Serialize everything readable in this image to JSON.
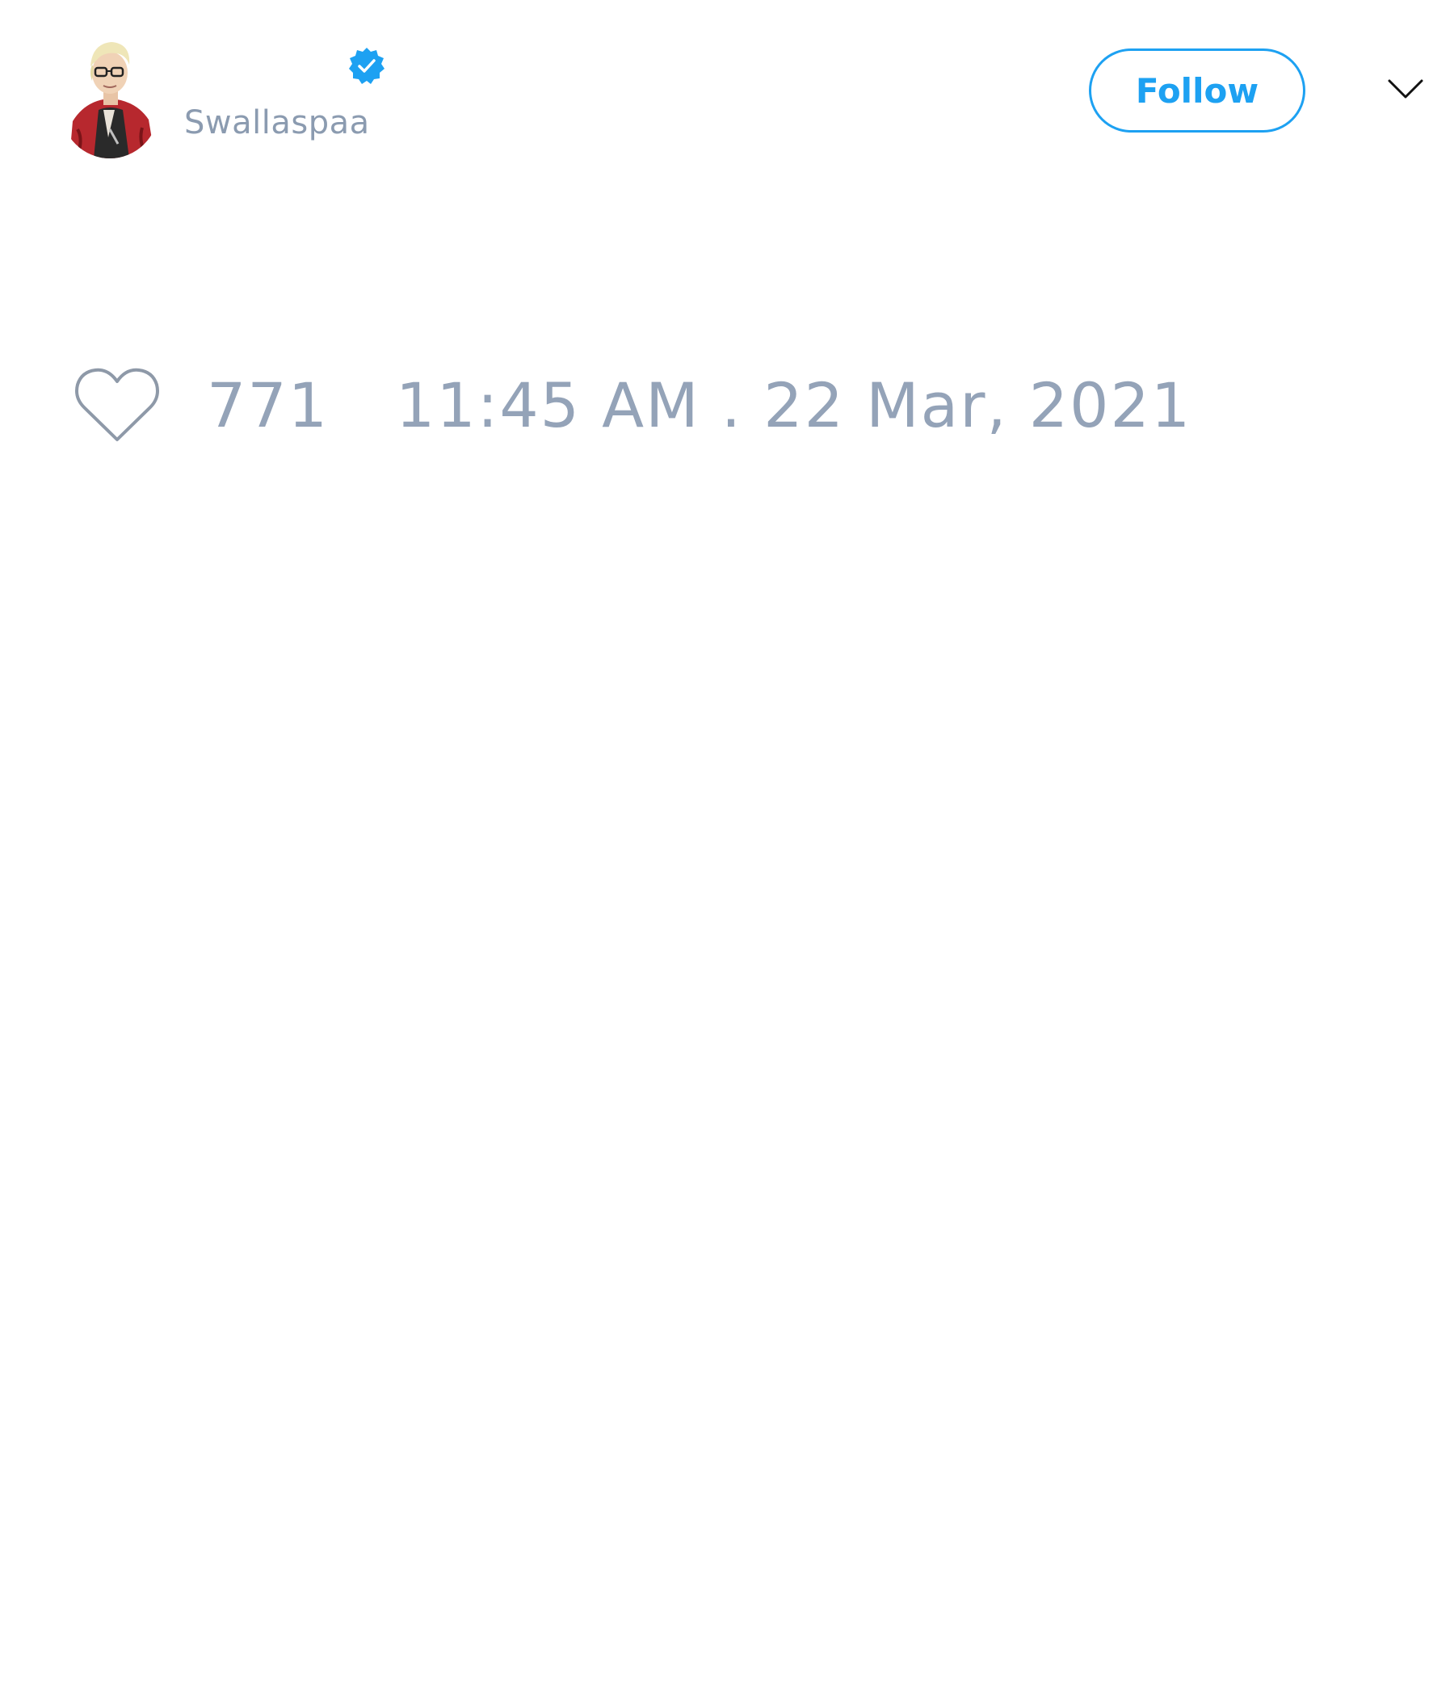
{
  "author": {
    "handle": "Swallaspaa",
    "verified_icon": "verified-badge-icon",
    "avatar_icon": "avatar"
  },
  "actions": {
    "follow_label": "Follow",
    "menu_icon": "chevron-down-icon"
  },
  "engagement": {
    "like_icon": "heart-icon",
    "like_count": "771"
  },
  "meta": {
    "timestamp": "11:45 AM . 22 Mar, 2021"
  },
  "colors": {
    "accent": "#1da1f2",
    "muted_text": "#94a3b8",
    "background": "#ffffff"
  }
}
